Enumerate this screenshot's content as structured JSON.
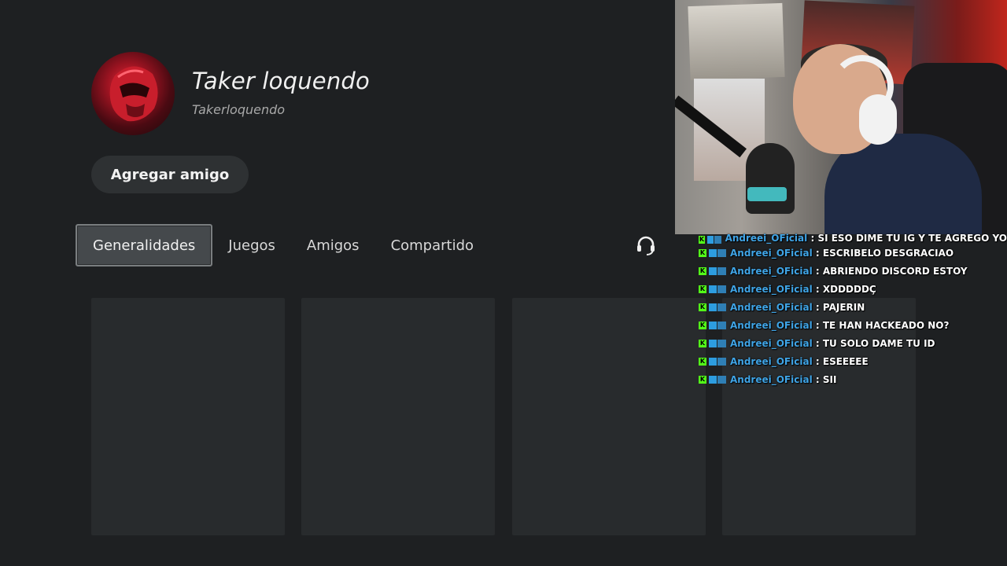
{
  "profile": {
    "display_name": "Taker loquendo",
    "online_id": "Takerloquendo"
  },
  "actions": {
    "add_friend": "Agregar amigo"
  },
  "tabs": [
    {
      "label": "Generalidades",
      "active": true
    },
    {
      "label": "Juegos",
      "active": false
    },
    {
      "label": "Amigos",
      "active": false
    },
    {
      "label": "Compartido",
      "active": false
    }
  ],
  "icons": {
    "voice_chat": "headset-icon"
  },
  "colors": {
    "background": "#1e2022",
    "card": "#282b2d",
    "chat_username": "#3fa4e6",
    "chat_badge": "#53fc18"
  },
  "chat": {
    "separator": ":",
    "messages": [
      {
        "user": "Andreei_OFicial",
        "text": "SI ESO DIME TU IG Y TE AGREGO YO"
      },
      {
        "user": "Andreei_OFicial",
        "text": "ESCRIBELO DESGRACIAO"
      },
      {
        "user": "Andreei_OFicial",
        "text": "ABRIENDO DISCORD ESTOY"
      },
      {
        "user": "Andreei_OFicial",
        "text": "XDDDDDÇ"
      },
      {
        "user": "Andreei_OFicial",
        "text": "PAJERIN"
      },
      {
        "user": "Andreei_OFicial",
        "text": "TE HAN HACKEADO NO?"
      },
      {
        "user": "Andreei_OFicial",
        "text": "TU SOLO DAME TU ID"
      },
      {
        "user": "Andreei_OFicial",
        "text": "ESEEEEE"
      },
      {
        "user": "Andreei_OFicial",
        "text": "SII"
      }
    ]
  }
}
